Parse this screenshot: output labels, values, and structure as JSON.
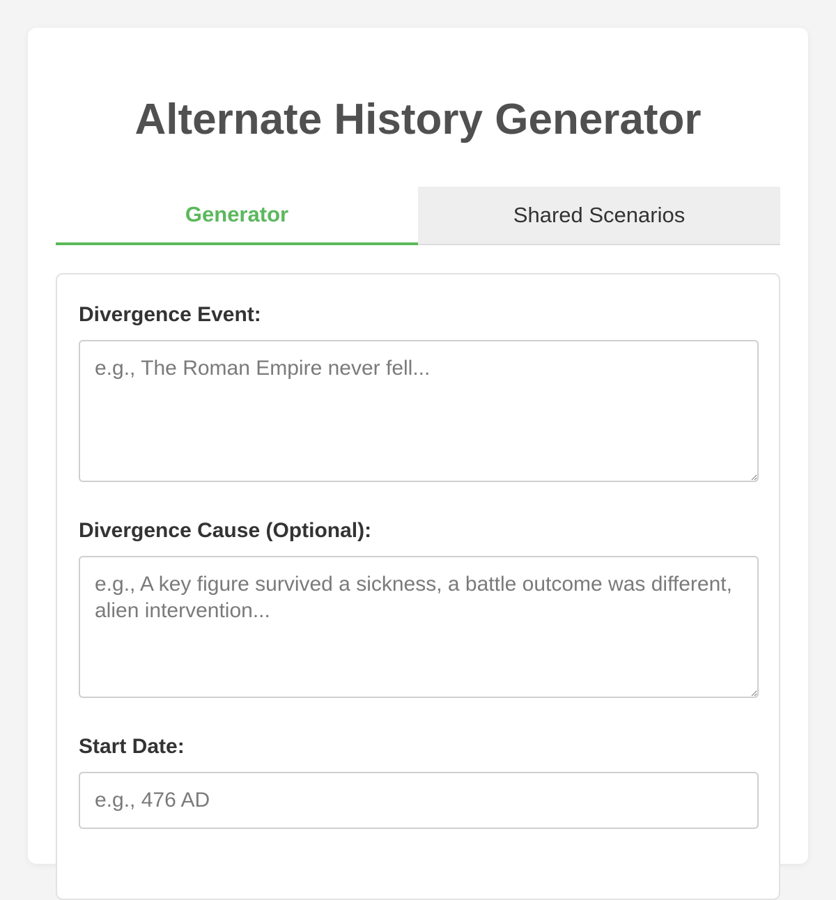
{
  "page": {
    "title": "Alternate History Generator"
  },
  "tabs": [
    {
      "label": "Generator",
      "active": true
    },
    {
      "label": "Shared Scenarios",
      "active": false
    }
  ],
  "form": {
    "divergence_event": {
      "label": "Divergence Event:",
      "value": "",
      "placeholder": "e.g., The Roman Empire never fell..."
    },
    "divergence_cause": {
      "label": "Divergence Cause (Optional):",
      "value": "",
      "placeholder": "e.g., A key figure survived a sickness, a battle outcome was different, alien intervention..."
    },
    "start_date": {
      "label": "Start Date:",
      "value": "",
      "placeholder": "e.g., 476 AD"
    }
  },
  "colors": {
    "accent": "#5cb85c",
    "title": "#505050",
    "background": "#f4f4f4"
  }
}
